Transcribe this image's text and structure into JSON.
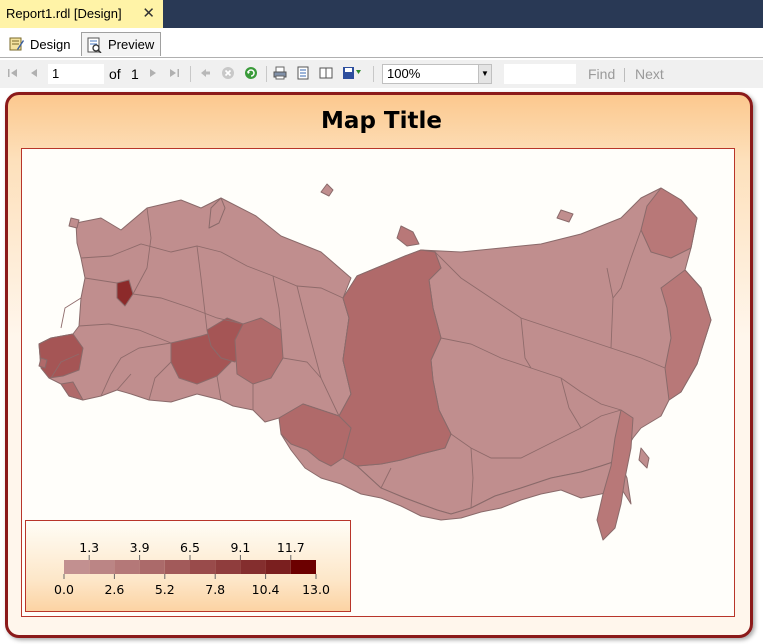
{
  "window": {
    "doc_tab_title": "Report1.rdl [Design]",
    "close_glyph": "✕"
  },
  "view_tabs": [
    {
      "label": "Design",
      "icon": "design-icon"
    },
    {
      "label": "Preview",
      "icon": "preview-icon"
    }
  ],
  "toolbar": {
    "current_page": "1",
    "of_label": "of",
    "total_pages": "1",
    "zoom": "100%",
    "find_label": "Find",
    "next_label": "Next",
    "icons": [
      "first-page-icon",
      "previous-page-icon",
      "next-page-icon",
      "last-page-icon",
      "back-icon",
      "stop-icon",
      "refresh-icon",
      "print-icon",
      "print-layout-icon",
      "page-setup-icon",
      "export-icon"
    ]
  },
  "report": {
    "map_title": "Map Title",
    "legend": {
      "top_labels": [
        "1.3",
        "3.9",
        "6.5",
        "9.1",
        "11.7"
      ],
      "bottom_labels": [
        "0.0",
        "2.6",
        "5.2",
        "7.8",
        "10.4",
        "13.0"
      ],
      "colors": [
        "#c29090",
        "#bb8585",
        "#b47878",
        "#ab6a6a",
        "#a25a5a",
        "#994b4b",
        "#8f3d3d",
        "#842e2e",
        "#7a1f1f",
        "#6c0000"
      ]
    },
    "colors": {
      "frame_border": "#8b1a1a",
      "region_base": "#c08e8e",
      "region_mid": "#b06a6a",
      "region_dark": "#9f4b4b",
      "region_darkest": "#8c2a2a",
      "region_border": "#8a6a6a"
    }
  }
}
